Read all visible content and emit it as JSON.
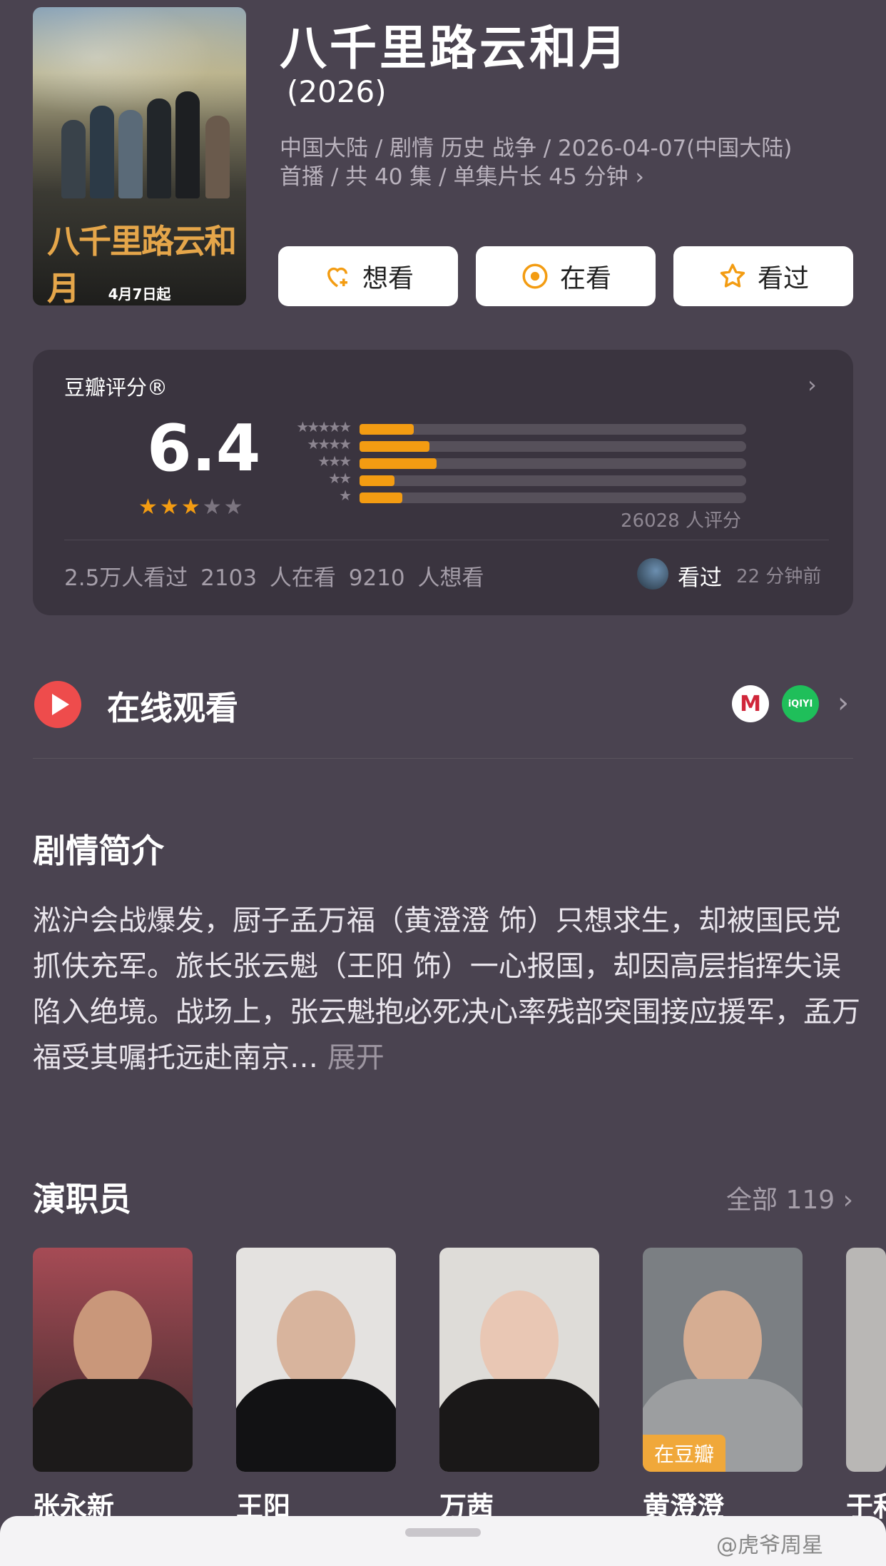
{
  "poster": {
    "title_art": "八千里路云和月",
    "date_text": "4月7日起"
  },
  "show": {
    "title": "八千里路云和月",
    "year": "(2026)",
    "meta_line1": "中国大陆 / 剧情 历史 战争 / 2026-04-07(中国大陆)",
    "meta_line2": "首播 / 共 40 集 / 单集片长 45 分钟 ›"
  },
  "actions": [
    {
      "label": "想看",
      "icon": "heart-plus-icon"
    },
    {
      "label": "在看",
      "icon": "target-icon"
    },
    {
      "label": "看过",
      "icon": "star-icon"
    }
  ],
  "rating": {
    "label": "豆瓣评分®",
    "score": "6.4",
    "stars": 3,
    "votes": "26028 人评分",
    "distribution": [
      {
        "stars": 5,
        "fraction": 0.14
      },
      {
        "stars": 4,
        "fraction": 0.18
      },
      {
        "stars": 3,
        "fraction": 0.2
      },
      {
        "stars": 2,
        "fraction": 0.09
      },
      {
        "stars": 1,
        "fraction": 0.11
      }
    ],
    "stats": "2.5万人看过   2103 人在看   9210 人想看",
    "activity_text": "看过",
    "activity_time": "22 分钟前"
  },
  "online": {
    "title": "在线观看",
    "platform1": "M",
    "platform2": "iQIYI"
  },
  "synopsis": {
    "title": "剧情简介",
    "text": "淞沪会战爆发，厨子孟万福（黄澄澄 饰）只想求生，却被国民党抓伕充军。旅长张云魁（王阳 饰）一心报国，却因高层指挥失误陷入绝境。战场上，张云魁抱必死决心率残部突围接应援军，孟万福受其嘱托远赴南京…",
    "more": " 展开"
  },
  "cast": {
    "title": "演职员",
    "all_label": "全部 119 ›",
    "members": [
      {
        "name": "张永新"
      },
      {
        "name": "王阳"
      },
      {
        "name": "万茜"
      },
      {
        "name": "黄澄澄",
        "badge": "在豆瓣"
      },
      {
        "name": "于和"
      }
    ]
  },
  "watermark": "@虎爷周星",
  "colors": {
    "accent": "#f39c12",
    "bg": "#4a4350",
    "card": "#3a343f",
    "play": "#ee4c4c"
  }
}
